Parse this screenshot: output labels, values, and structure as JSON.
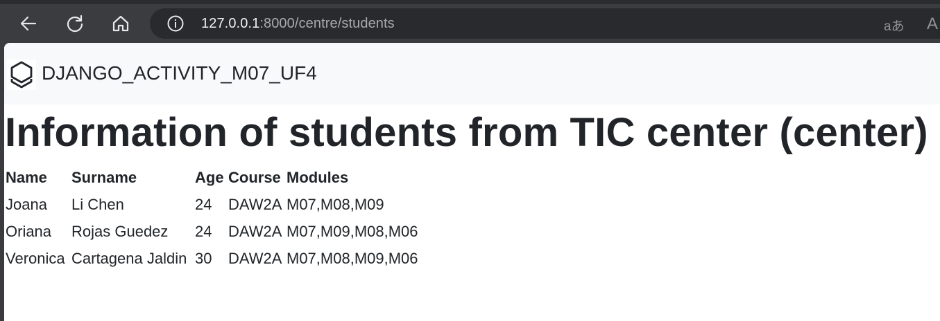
{
  "browser": {
    "url_host": "127.0.0.1",
    "url_rest": ":8000/centre/students",
    "read_aloud_glyph": "aあ",
    "font_glyph": "A"
  },
  "navbar": {
    "brand": "DJANGO_ACTIVITY_M07_UF4"
  },
  "main": {
    "title": "Information of students from TIC center (center)",
    "table": {
      "headers": [
        "Name",
        "Surname",
        "Age",
        "Course",
        "Modules"
      ],
      "rows": [
        [
          "Joana",
          "Li Chen",
          "24",
          "DAW2A",
          "M07,M08,M09"
        ],
        [
          "Oriana",
          "Rojas Guedez",
          "24",
          "DAW2A",
          "M07,M09,M08,M06"
        ],
        [
          "Veronica",
          "Cartagena Jaldin",
          "30",
          "DAW2A",
          "M07,M08,M09,M06"
        ]
      ]
    }
  }
}
